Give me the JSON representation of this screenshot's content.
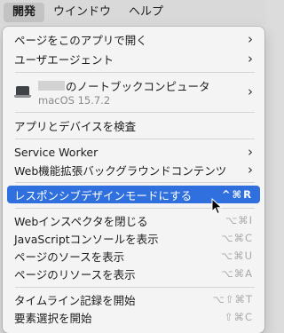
{
  "menubar": {
    "items": [
      "開発",
      "ウインドウ",
      "ヘルプ"
    ]
  },
  "menu": {
    "items": {
      "open_page_with": "ページをこのアプリで開く",
      "user_agent": "ユーザエージェント",
      "device_name": "のノートブックコンピュータ",
      "device_os": "macOS 15.7.2",
      "inspect_apps": "アプリとデバイスを検査",
      "service_worker": "Service Worker",
      "web_extension_bg": "Web機能拡張バックグラウンドコンテンツ",
      "responsive_mode": "レスポンシブデザインモードにする",
      "responsive_shortcut": "^⌘R",
      "close_inspector": "Webインスペクタを閉じる",
      "close_inspector_shortcut": "⌥⌘I",
      "js_console": "JavaScriptコンソールを表示",
      "js_console_shortcut": "⌥⌘C",
      "page_source": "ページのソースを表示",
      "page_source_shortcut": "⌥⌘U",
      "page_resources": "ページのリソースを表示",
      "page_resources_shortcut": "⌥⌘A",
      "timeline_record": "タイムライン記録を開始",
      "timeline_record_shortcut": "⌥⇧⌘T",
      "element_select": "要素選択を開始",
      "element_select_shortcut": "⇧⌘C"
    }
  },
  "colors": {
    "highlight": "#2f6fde",
    "menu_bg": "#f4f4f4",
    "shortcut_gray": "#a9a9a9"
  },
  "icons": {
    "device": "laptop-icon",
    "submenu": "chevron-right-icon",
    "pointer": "mouse-cursor-icon"
  }
}
